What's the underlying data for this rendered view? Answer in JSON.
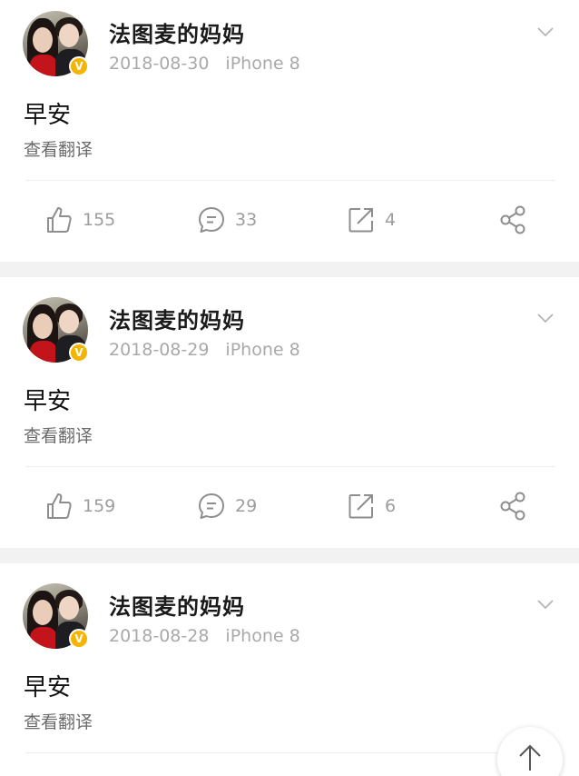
{
  "posts": [
    {
      "username": "法图麦的妈妈",
      "date": "2018-08-30",
      "device": "iPhone 8",
      "text": "早安",
      "translate_label": "查看翻译",
      "likes": "155",
      "comments": "33",
      "reposts": "4"
    },
    {
      "username": "法图麦的妈妈",
      "date": "2018-08-29",
      "device": "iPhone 8",
      "text": "早安",
      "translate_label": "查看翻译",
      "likes": "159",
      "comments": "29",
      "reposts": "6"
    },
    {
      "username": "法图麦的妈妈",
      "date": "2018-08-28",
      "device": "iPhone 8",
      "text": "早安",
      "translate_label": "查看翻译"
    }
  ],
  "icons": {
    "like": "thumbs-up-icon",
    "comment": "comment-bubble-icon",
    "repost": "repost-icon",
    "share": "share-icon",
    "menu": "chevron-down-icon",
    "verified": "verified-badge-icon",
    "back_to_top": "arrow-up-icon"
  },
  "colors": {
    "verified_badge": "#f4b400",
    "meta_text": "#a9a9a9",
    "separator": "#f2f2f2"
  }
}
